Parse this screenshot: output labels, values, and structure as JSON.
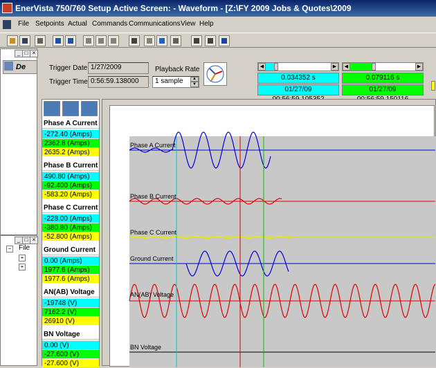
{
  "app": {
    "title": "EnerVista 750/760 Setup Active Screen: - Waveform - [Z:\\FY 2009 Jobs & Quotes\\2009"
  },
  "menu": {
    "items": [
      "File",
      "Setpoints",
      "Actual",
      "Commands",
      "Communications",
      "View",
      "Help"
    ]
  },
  "left_panel": {
    "tab_label": "De",
    "tree_root": "File"
  },
  "trigger": {
    "date_label": "Trigger Date",
    "date_value": "1/27/2009",
    "time_label": "Trigger Time",
    "time_value": "0:56:59.138000",
    "playback_label": "Playback Rate",
    "playback_value": "1 sample"
  },
  "cursors": {
    "cursor1": {
      "delta": "0.034352 s",
      "timestamp": "01/27/09 00:56:59.105352",
      "color": "#00ffff",
      "fraction": 0.12
    },
    "cursor2": {
      "delta": "0.079116 s",
      "timestamp": "01/27/09 00:56:59.150116",
      "color": "#00ff00",
      "fraction": 0.32
    }
  },
  "channels": [
    {
      "name": "Phase A Current",
      "values": [
        "-272.40 (Amps)",
        "2362.8 (Amps)",
        "2635.2 (Amps)"
      ]
    },
    {
      "name": "Phase B Current",
      "values": [
        "490.80 (Amps)",
        "-92.400 (Amps)",
        "-583.20 (Amps)"
      ]
    },
    {
      "name": "Phase C Current",
      "values": [
        "-228.00 (Amps)",
        "-380.80 (Amps)",
        "-52.800 (Amps)"
      ]
    },
    {
      "name": "Ground Current",
      "values": [
        "0.00 (Amps)",
        "1977.6 (Amps)",
        "1977.6 (Amps)"
      ]
    },
    {
      "name": "AN(AB) Voltage",
      "values": [
        "-19748 (V)",
        "7162.2 (V)",
        "26910 (V)"
      ]
    },
    {
      "name": "BN Voltage",
      "values": [
        "0.00 (V)",
        "-27.600 (V)",
        "-27.600 (V)"
      ]
    }
  ],
  "legend_colors": [
    "#00ffff",
    "#00ff00",
    "#ffff00"
  ],
  "waveform": {
    "traces": [
      {
        "label": "Phase A Current",
        "color": "#0000e0"
      },
      {
        "label": "Phase B Current",
        "color": "#e00000"
      },
      {
        "label": "Phase C Current",
        "color": "#e8e800"
      },
      {
        "label": "Ground Current",
        "color": "#0000e0"
      },
      {
        "label": "AN(AB) Voltage",
        "color": "#e00000"
      },
      {
        "label": "BN Voltage",
        "color": "#000000"
      }
    ],
    "markers": [
      {
        "name": "cursor-1",
        "color": "#00c8c8"
      },
      {
        "name": "trigger",
        "color": "#e00000"
      },
      {
        "name": "cursor-2",
        "color": "#00c000"
      }
    ]
  }
}
